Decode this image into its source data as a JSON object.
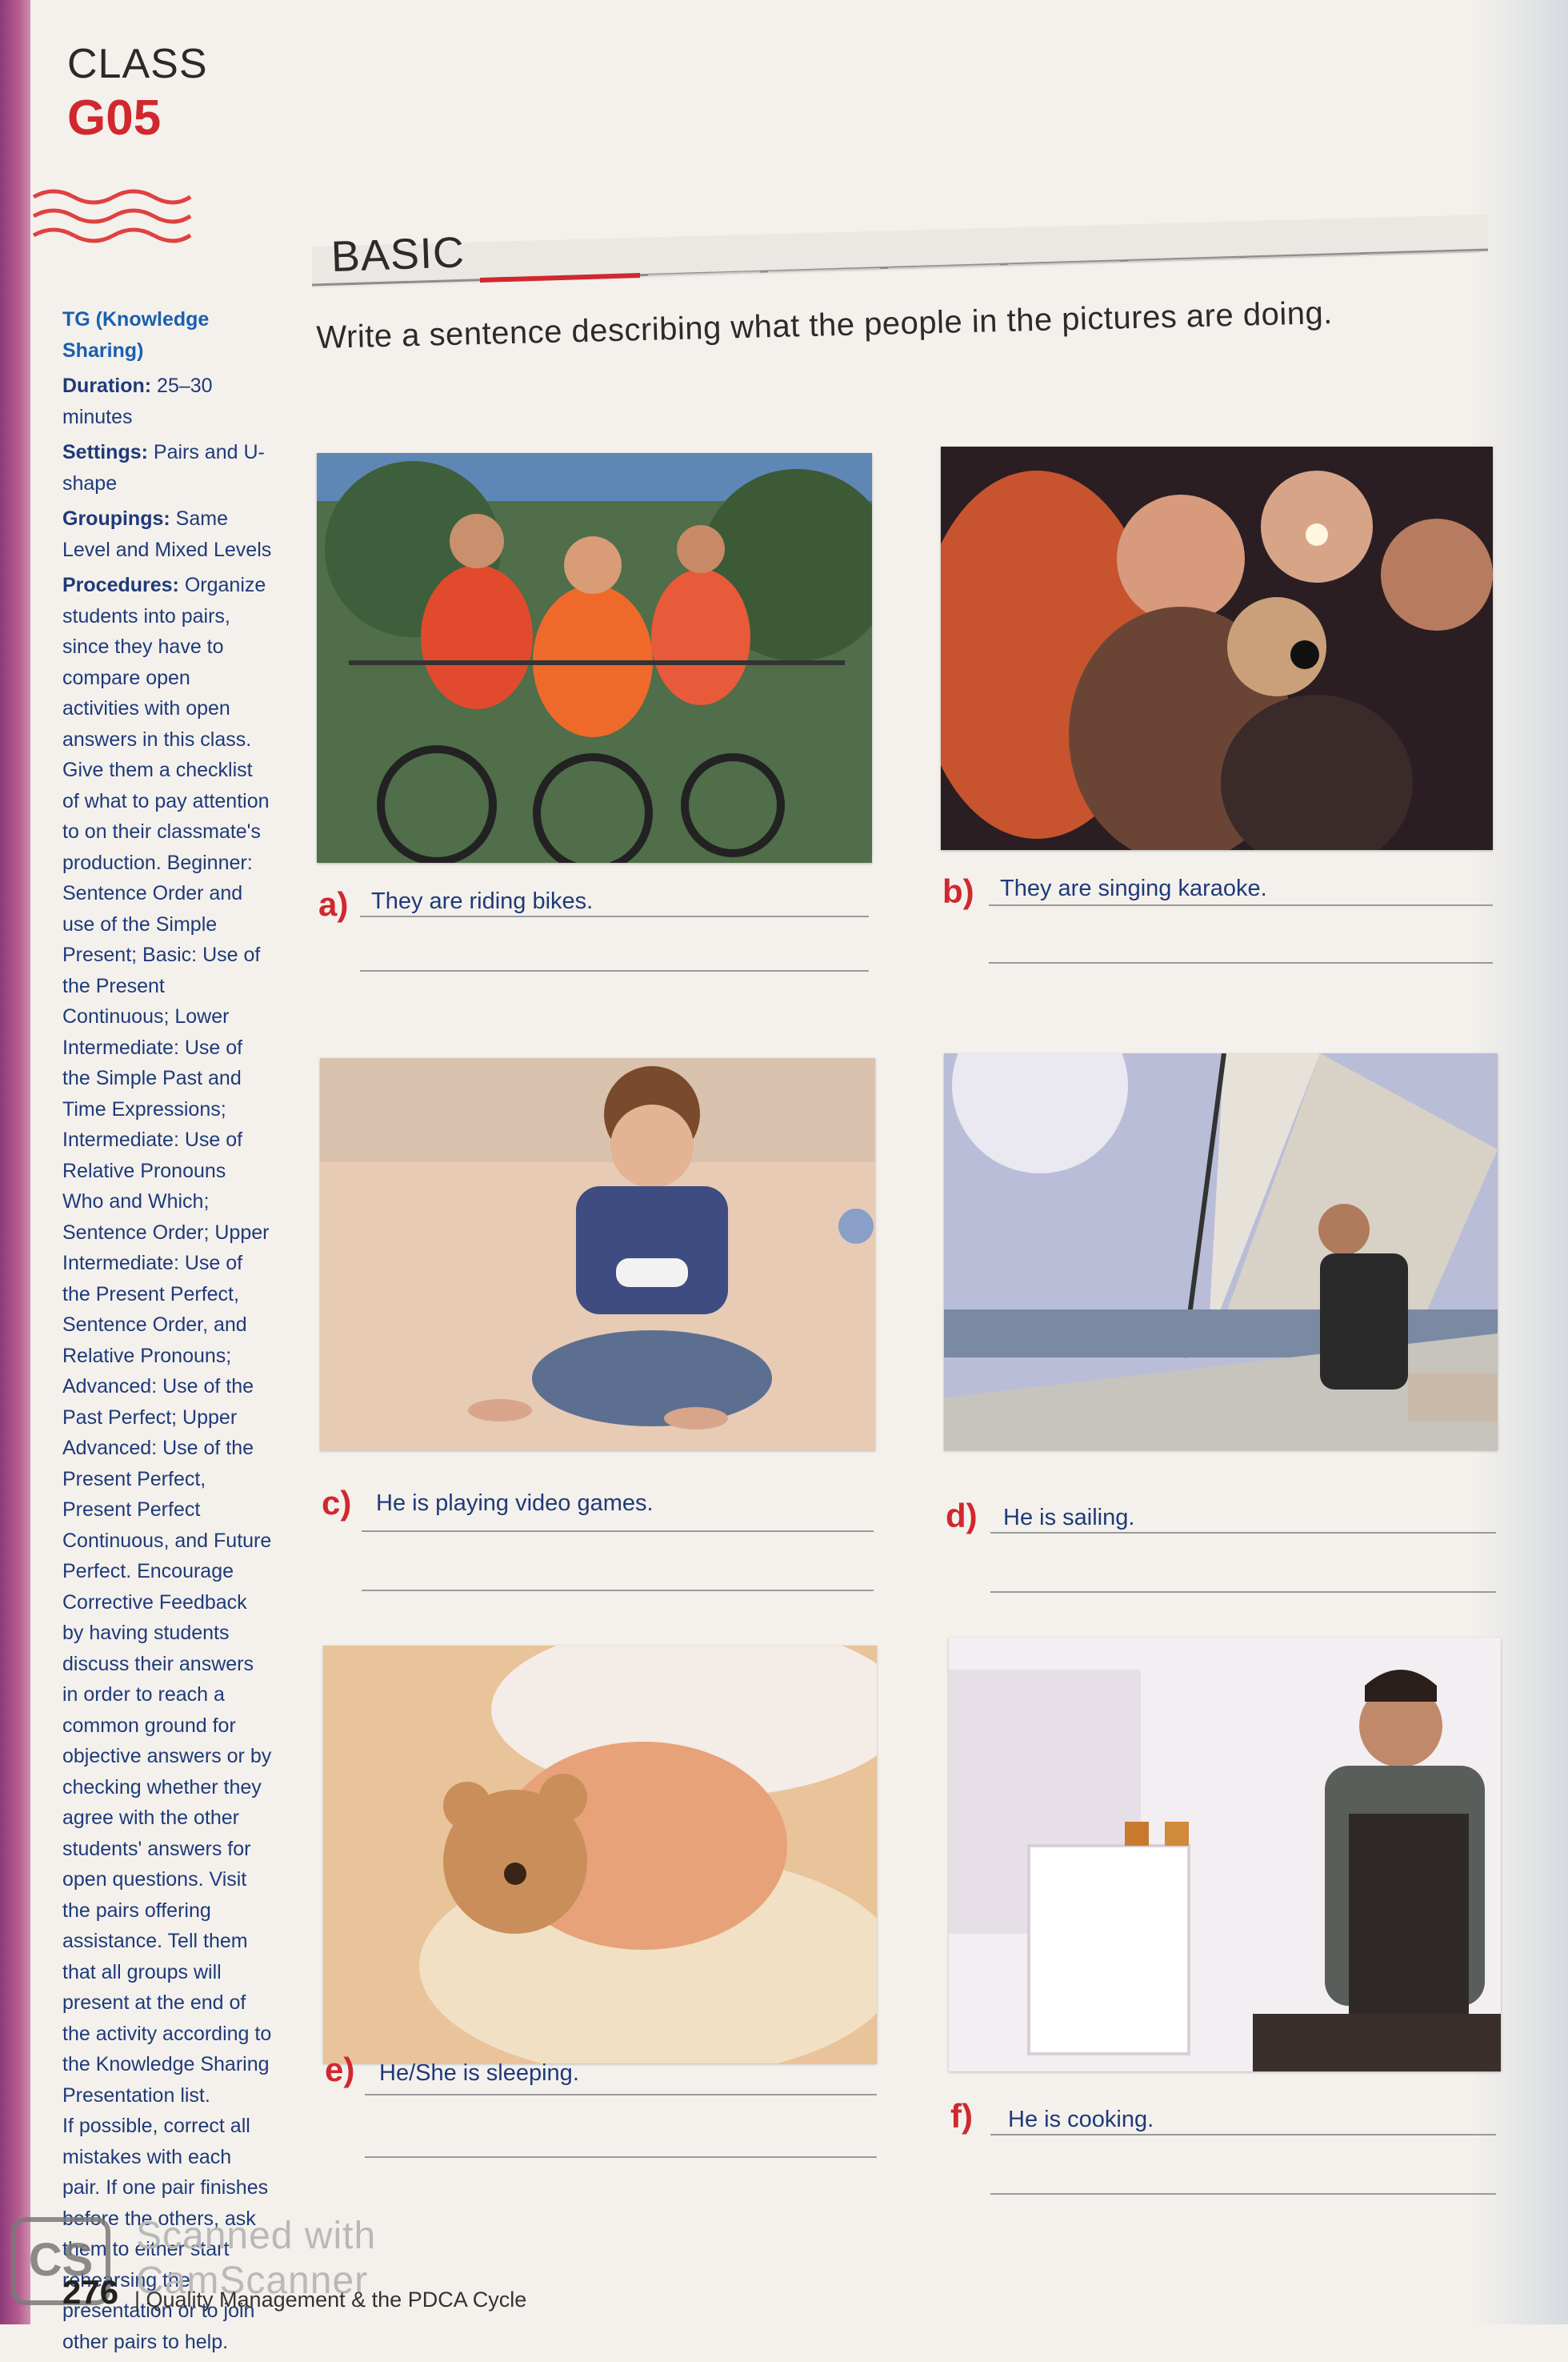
{
  "header": {
    "class_label": "CLASS",
    "class_code": "G05"
  },
  "section": {
    "title": "BASIC",
    "instruction": "Write a sentence describing what the people in the pictures are doing."
  },
  "sidebar": {
    "tg": "TG (Knowledge Sharing)",
    "duration_label": "Duration:",
    "duration": " 25–30 minutes",
    "settings_label": "Settings:",
    "settings": " Pairs and U-shape",
    "groupings_label": "Groupings:",
    "groupings": " Same Level and Mixed Levels",
    "procedures_label": "Procedures:",
    "procedures": " Organize students into pairs, since they have to compare open activities with open answers in this class. Give them a checklist of what to pay attention to on their classmate's production. Beginner: Sentence Order and use of the Simple Present; Basic: Use of the Present Continuous; Lower Intermediate: Use of the Simple Past and Time Expressions; Intermediate: Use of Relative Pronouns Who and Which; Sentence Order; Upper Intermediate: Use of the Present Perfect, Sentence Order, and Relative Pronouns; Advanced: Use of the Past Perfect; Upper Advanced: Use of the Present Perfect, Present Perfect Continuous, and Future Perfect. Encourage Corrective Feedback by having students discuss their answers in order to reach a common ground for objective answers or by checking whether they agree with the other students' answers for open questions. Visit the pairs offering assistance. Tell them that all groups will present at the end of the activity according to the Knowledge Sharing Presentation list.",
    "closing": "If possible, correct all mistakes with each pair. If one pair finishes before the others, ask them to either start rehearsing the presentation or to join other pairs to help."
  },
  "items": [
    {
      "letter": "a)",
      "answer": "They are riding bikes.",
      "image": "cyclists-photo"
    },
    {
      "letter": "b)",
      "answer": "They are singing karaoke.",
      "image": "karaoke-photo"
    },
    {
      "letter": "c)",
      "answer": "He is playing video games.",
      "image": "boy-gaming-photo"
    },
    {
      "letter": "d)",
      "answer": "He is sailing.",
      "image": "sailing-photo"
    },
    {
      "letter": "e)",
      "answer": "He/She is sleeping.",
      "image": "baby-sleeping-photo"
    },
    {
      "letter": "f)",
      "answer": "He is cooking.",
      "image": "man-cooking-photo"
    }
  ],
  "footer": {
    "page_number": "276",
    "running_title": "|  Quality Management & the PDCA Cycle",
    "watermark_logo": "CS",
    "watermark_line1": "Scanned with",
    "watermark_line2": "CamScanner"
  },
  "colors": {
    "accent_red": "#d0282e",
    "sidebar_blue": "#1f3a7a",
    "spine": "#8c3a7a"
  }
}
